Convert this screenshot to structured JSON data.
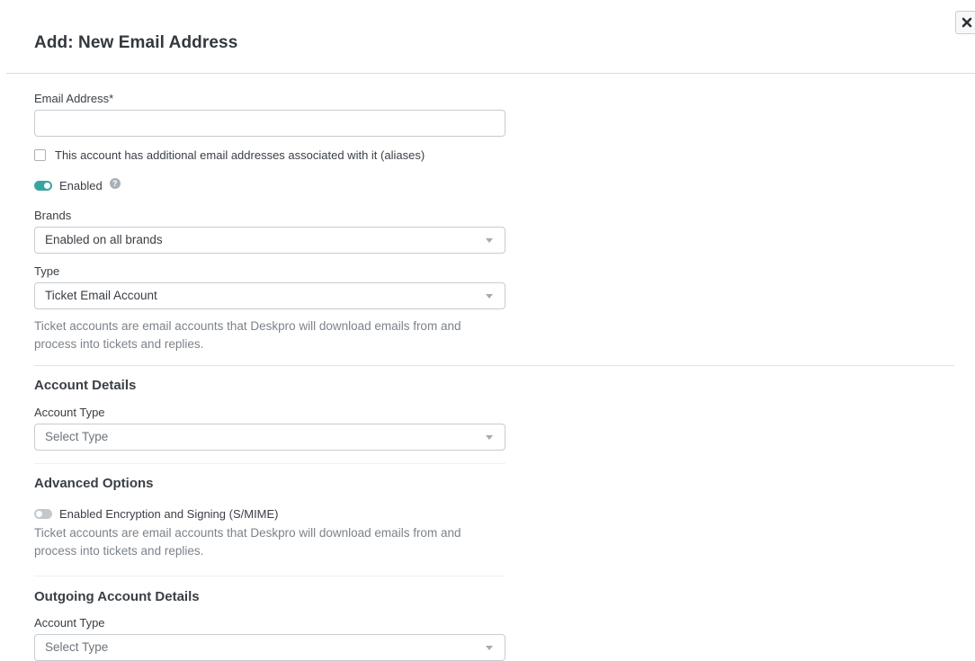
{
  "dialog": {
    "title": "Add: New Email Address"
  },
  "email": {
    "label": "Email Address*",
    "value": "",
    "placeholder": ""
  },
  "aliases": {
    "label": "This account has additional email addresses associated with it (aliases)",
    "checked": false
  },
  "enabled": {
    "label": "Enabled",
    "on": true
  },
  "brands": {
    "label": "Brands",
    "selected": "Enabled on all brands"
  },
  "type": {
    "label": "Type",
    "selected": "Ticket Email Account",
    "help": "Ticket accounts are email accounts that Deskpro will download emails from and process into tickets and replies."
  },
  "account_details": {
    "title": "Account Details",
    "account_type_label": "Account Type",
    "account_type_value": "Select Type"
  },
  "advanced_options": {
    "title": "Advanced Options",
    "smime_label": "Enabled Encryption and Signing (S/MIME)",
    "smime_on": false,
    "help": "Ticket accounts are email accounts that Deskpro will download emails from and process into tickets and replies."
  },
  "outgoing_account_details": {
    "title": "Outgoing Account Details",
    "account_type_label": "Account Type",
    "account_type_value": "Select Type"
  },
  "colors": {
    "accent": "#3aa5a0",
    "help_text": "#7c838a"
  },
  "icons": {
    "close": "close-icon",
    "help": "help-icon",
    "caret": "chevron-down-icon"
  }
}
